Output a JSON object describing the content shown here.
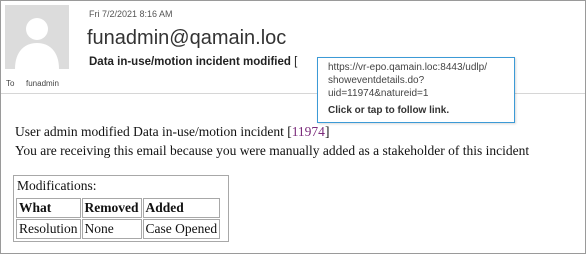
{
  "email": {
    "date": "Fri 7/2/2021 8:16 AM",
    "from": "funadmin@qamain.loc",
    "subject": "Data in-use/motion incident modified",
    "subject_bracket": "[",
    "to_label": "To",
    "to_name": "funadmin"
  },
  "tooltip": {
    "url_line1": "https://vr-epo.qamain.loc:8443/udlp/",
    "url_line2": "showeventdetails.do?",
    "url_line3": "uid=11974&natureid=1",
    "hint": "Click or tap to follow link."
  },
  "body": {
    "line1_prefix": "User admin modified Data in-use/motion incident [",
    "incident_link": "11974",
    "line1_suffix": "]",
    "line2": "You are receiving this email because you were manually added as a stakeholder of this incident"
  },
  "modifications": {
    "caption": "Modifications:",
    "headers": [
      "What",
      "Removed",
      "Added"
    ],
    "rows": [
      [
        "Resolution",
        "None",
        "Case Opened"
      ]
    ]
  },
  "colors": {
    "link": "#7a2a7a",
    "tooltip_border": "#3c9ad6"
  },
  "icons": {
    "avatar": "person-silhouette-icon"
  }
}
